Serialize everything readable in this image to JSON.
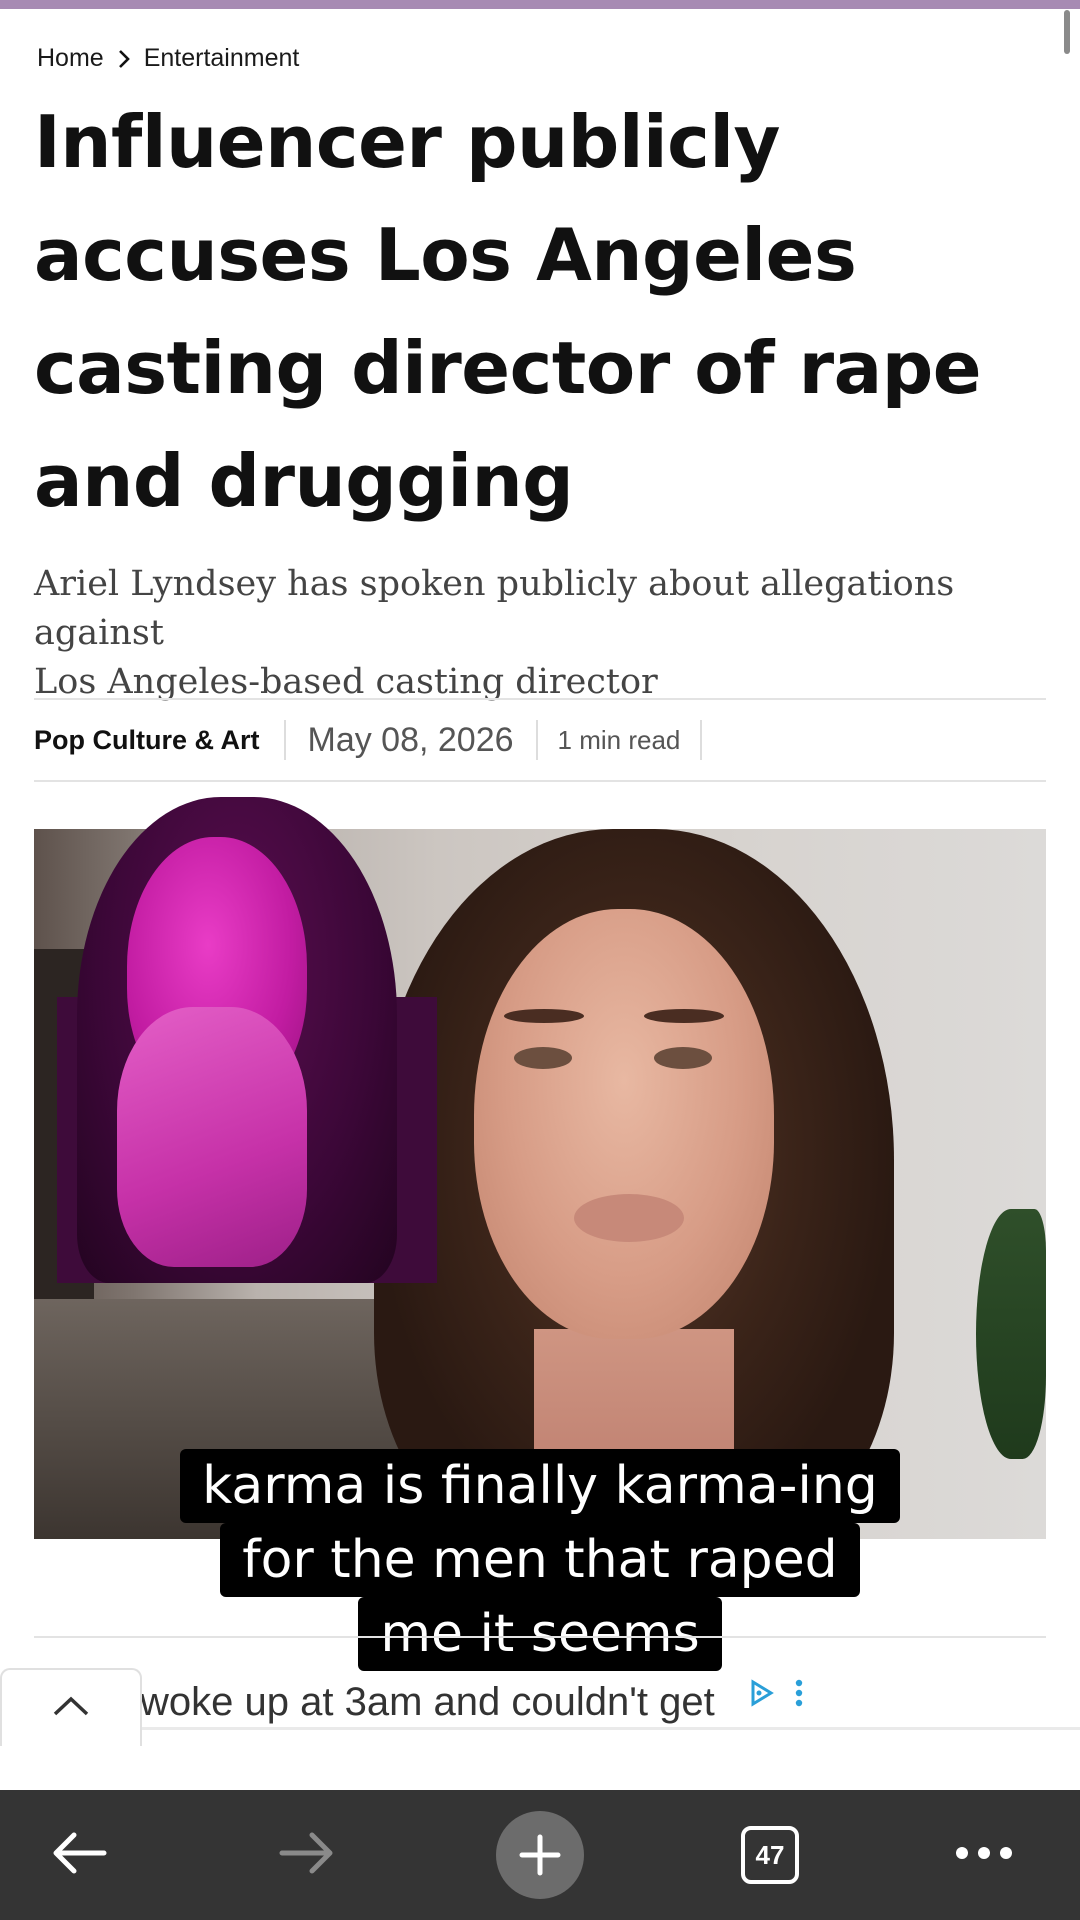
{
  "breadcrumb": {
    "home": "Home",
    "section": "Entertainment"
  },
  "article": {
    "headline_lines": [
      "Influencer publicly",
      "accuses Los Angeles",
      "casting director of rape",
      "and drugging"
    ],
    "dek_lines": [
      "Ariel Lyndsey has spoken publicly about allegations against",
      "Los Angeles-based casting director"
    ],
    "category": "Pop Culture & Art",
    "date": "May 08, 2026",
    "read_time": "1 min read"
  },
  "caption": {
    "lines": [
      "karma is finally karma-ing",
      "for the men that raped",
      "me it seems"
    ]
  },
  "ad": {
    "text": "woke up at 3am and couldn't get",
    "icons": [
      "adchoices-icon",
      "more-vertical-icon"
    ]
  },
  "browser_bar": {
    "tab_count": "47",
    "icons": [
      "back-arrow-icon",
      "forward-arrow-icon",
      "new-tab-plus-icon",
      "tabs-icon",
      "more-menu-icon"
    ]
  },
  "colors": {
    "top_bar": "#a78ab3",
    "bottom_bar": "#343434",
    "caption_bg": "#000000",
    "caption_text": "#ffffff"
  }
}
